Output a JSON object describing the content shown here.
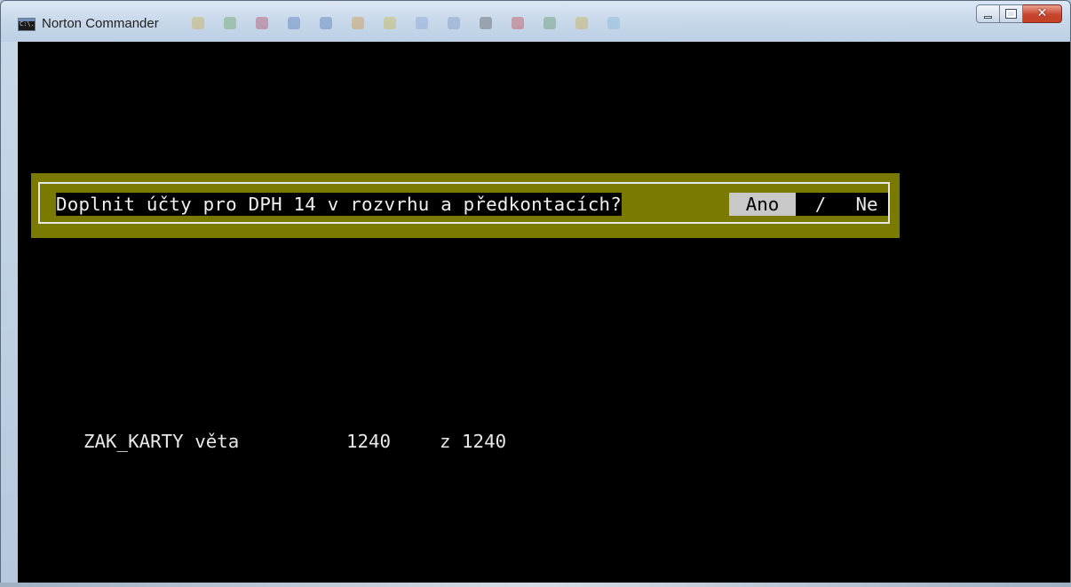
{
  "window": {
    "title": "Norton Commander",
    "app_icon_text": "C:\\.",
    "icons": {
      "app": "console-app-icon",
      "minimize": "minimize-icon",
      "maximize": "maximize-icon",
      "close": "close-icon"
    },
    "close_glyph": "✕"
  },
  "dialog": {
    "question": "Doplnit účty pro DPH 14 v rozvrhu a předkontacích?",
    "option_yes": "Ano",
    "separator": "/",
    "option_no": "Ne"
  },
  "status": {
    "table_label": "ZAK_KARTY věta",
    "current_record": "1240",
    "total_label": "z 1240"
  },
  "colors": {
    "console_bg": "#000000",
    "dialog_bg": "#7a7a00",
    "dialog_border": "#e6e6e6",
    "selected_option_bg": "#c8c8c8",
    "text": "#e8e8e8"
  }
}
